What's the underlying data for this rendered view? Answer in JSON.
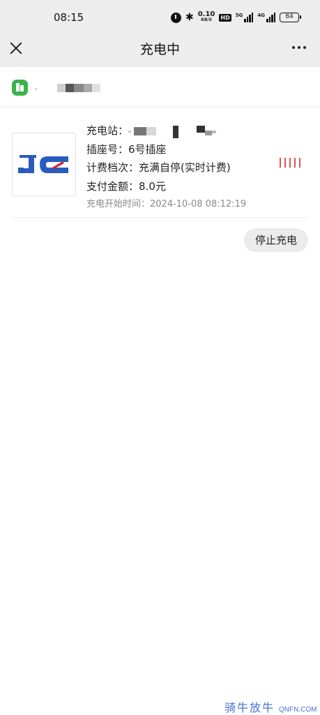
{
  "status_bar": {
    "time": "08:15",
    "net_speed_value": "0.10",
    "net_speed_unit": "KB/S",
    "hd_label": "HD",
    "signal1_label": "5G",
    "signal2_label": "4G",
    "battery": "84",
    "icons": [
      "alarm-icon",
      "bluetooth-icon",
      "signal-icon",
      "battery-icon"
    ]
  },
  "nav": {
    "title": "充电中",
    "close_icon": "close-icon",
    "more_icon": "more-icon"
  },
  "shop": {
    "icon": "building-icon",
    "icon_color": "#3ab34a"
  },
  "order": {
    "station_label": "充电站：",
    "socket_label": "插座号：",
    "socket_value": "6号插座",
    "plan_label": "计费档次：",
    "plan_value": "充满自停(实时计费)",
    "amount_label": "支付金额：",
    "amount_value": "8.0元",
    "start_label": "充电开始时间：",
    "start_value": "2024-10-08 08:12:19",
    "status_indicator_color": "#d9534f"
  },
  "actions": {
    "stop_label": "停止充电"
  },
  "watermark": {
    "cn": "骑牛放牛",
    "en": "QNFN.COM"
  }
}
